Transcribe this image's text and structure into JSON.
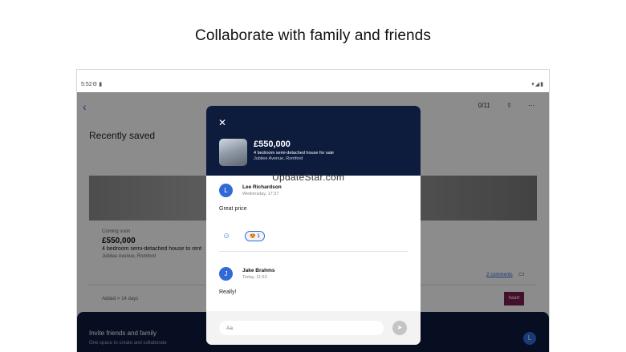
{
  "headline": "Collaborate with family and friends",
  "statusbar": {
    "time": "5:52",
    "left_icons": "⚙ ▮",
    "right_icons": "▾◢▮"
  },
  "app": {
    "back_icon": "chevron-left-icon",
    "back_glyph": "‹",
    "binoculars_counter": "0/11",
    "page_title": "Recently saved",
    "listing": {
      "status": "Coming soon",
      "price": "£550,000",
      "description": "4 bedroom semi-detached house to rent",
      "address": "Jubilee Avenue, Romford",
      "comments_link": "2 comments",
      "added": "Added < 14 days",
      "agent_logo": "haart"
    },
    "invite": {
      "title": "Invite friends and family",
      "subtitle": "One space to create and collaborate",
      "avatar_initial": "L"
    }
  },
  "modal": {
    "close_glyph": "✕",
    "price": "£550,000",
    "description": "4 bedroom semi-detached house for sale",
    "address": "Jubilee Avenue, Romford",
    "watermark": "UpdateStar.com",
    "comments": [
      {
        "initial": "L",
        "name": "Lee Richardson",
        "time": "Wednesday, 17:37",
        "text": "Great price",
        "reaction": "😍 1"
      },
      {
        "initial": "J",
        "name": "Jake Brahms",
        "time": "Today, 11:53",
        "text": "Really!"
      }
    ],
    "input_placeholder": "Aa",
    "send_glyph": "➤"
  },
  "colors": {
    "navy": "#0d1b3d",
    "accent": "#2f6ad8"
  }
}
